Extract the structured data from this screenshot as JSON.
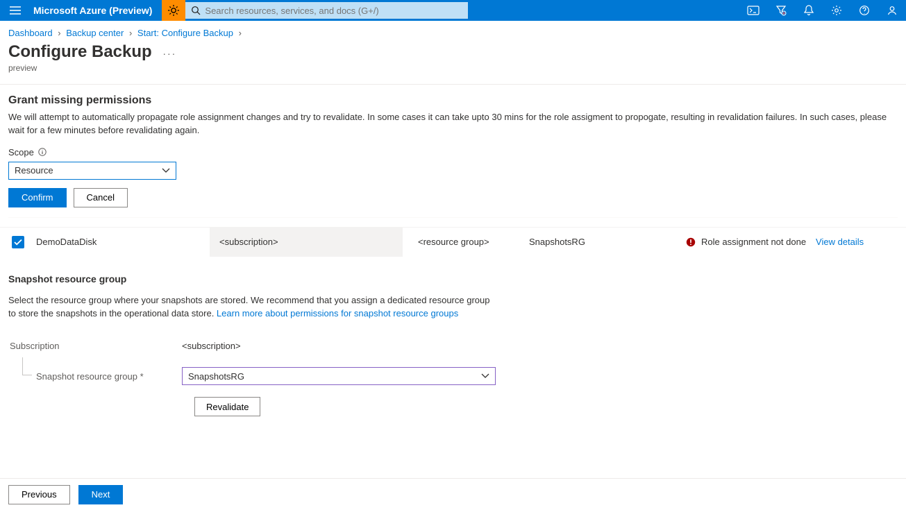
{
  "header": {
    "brand": "Microsoft Azure (Preview)",
    "search_placeholder": "Search resources, services, and docs (G+/)"
  },
  "breadcrumbs": {
    "items": [
      "Dashboard",
      "Backup center",
      "Start: Configure Backup"
    ]
  },
  "page": {
    "title": "Configure Backup",
    "subtitle": "preview"
  },
  "grant": {
    "title": "Grant missing permissions",
    "desc": "We will attempt to automatically propagate role assignment changes and try to revalidate. In some cases it can take upto 30 mins for the role assigment to propogate, resulting in revalidation failures. In such cases, please wait for a few minutes before revalidating again.",
    "scope_label": "Scope",
    "scope_value": "Resource",
    "confirm": "Confirm",
    "cancel": "Cancel"
  },
  "grid": {
    "row": {
      "name": "DemoDataDisk",
      "subscription": "<subscription>",
      "resource_group": "<resource group>",
      "snapshot_rg": "SnapshotsRG",
      "status": "Role assignment not done",
      "view": "View details"
    }
  },
  "snapshot": {
    "title": "Snapshot resource group",
    "desc": "Select the resource group where your snapshots are stored. We recommend that you assign a dedicated resource group to store the snapshots in the operational data store. ",
    "link": "Learn more about permissions for snapshot resource groups",
    "sub_label": "Subscription",
    "sub_value": "<subscription>",
    "rg_label": "Snapshot resource group *",
    "rg_value": "SnapshotsRG",
    "revalidate": "Revalidate"
  },
  "footer": {
    "previous": "Previous",
    "next": "Next"
  }
}
